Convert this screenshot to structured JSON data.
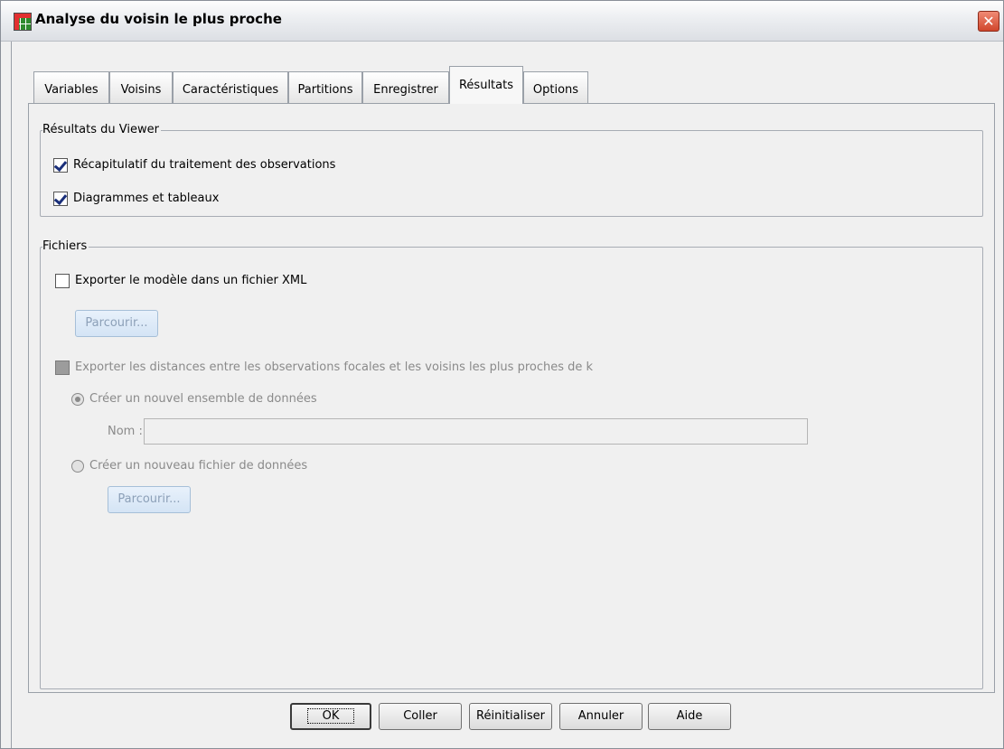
{
  "window": {
    "title": "Analyse du voisin le plus proche",
    "close_glyph": "✕"
  },
  "tabs": [
    {
      "label": "Variables",
      "active": false
    },
    {
      "label": "Voisins",
      "active": false
    },
    {
      "label": "Caractéristiques",
      "active": false
    },
    {
      "label": "Partitions",
      "active": false
    },
    {
      "label": "Enregistrer",
      "active": false
    },
    {
      "label": "Résultats",
      "active": true
    },
    {
      "label": "Options",
      "active": false
    }
  ],
  "viewer_group": {
    "title": "Résultats du Viewer",
    "summary_checkbox": {
      "label": "Récapitulatif du traitement des observations",
      "checked": true
    },
    "charts_checkbox": {
      "label": "Diagrammes et tableaux",
      "checked": true
    }
  },
  "files_group": {
    "title": "Fichiers",
    "export_xml": {
      "label": "Exporter le modèle dans un fichier XML",
      "checked": false
    },
    "browse_xml_label": "Parcourir...",
    "export_distances": {
      "label": "Exporter les distances entre les observations focales et les voisins les plus proches de k",
      "checked": false,
      "enabled": false
    },
    "new_dataset_radio": {
      "label": "Créer un nouvel ensemble de données",
      "selected": true
    },
    "name_label": "Nom :",
    "name_value": "",
    "new_file_radio": {
      "label": "Créer un nouveau fichier de données",
      "selected": false
    },
    "browse_file_label": "Parcourir..."
  },
  "buttons": {
    "ok": "OK",
    "paste": "Coller",
    "reset": "Réinitialiser",
    "cancel": "Annuler",
    "help": "Aide"
  },
  "colors": {
    "close_button": "#d0462c",
    "checkmark": "#1a2f7a",
    "disabled_text": "#8a8a8a"
  }
}
